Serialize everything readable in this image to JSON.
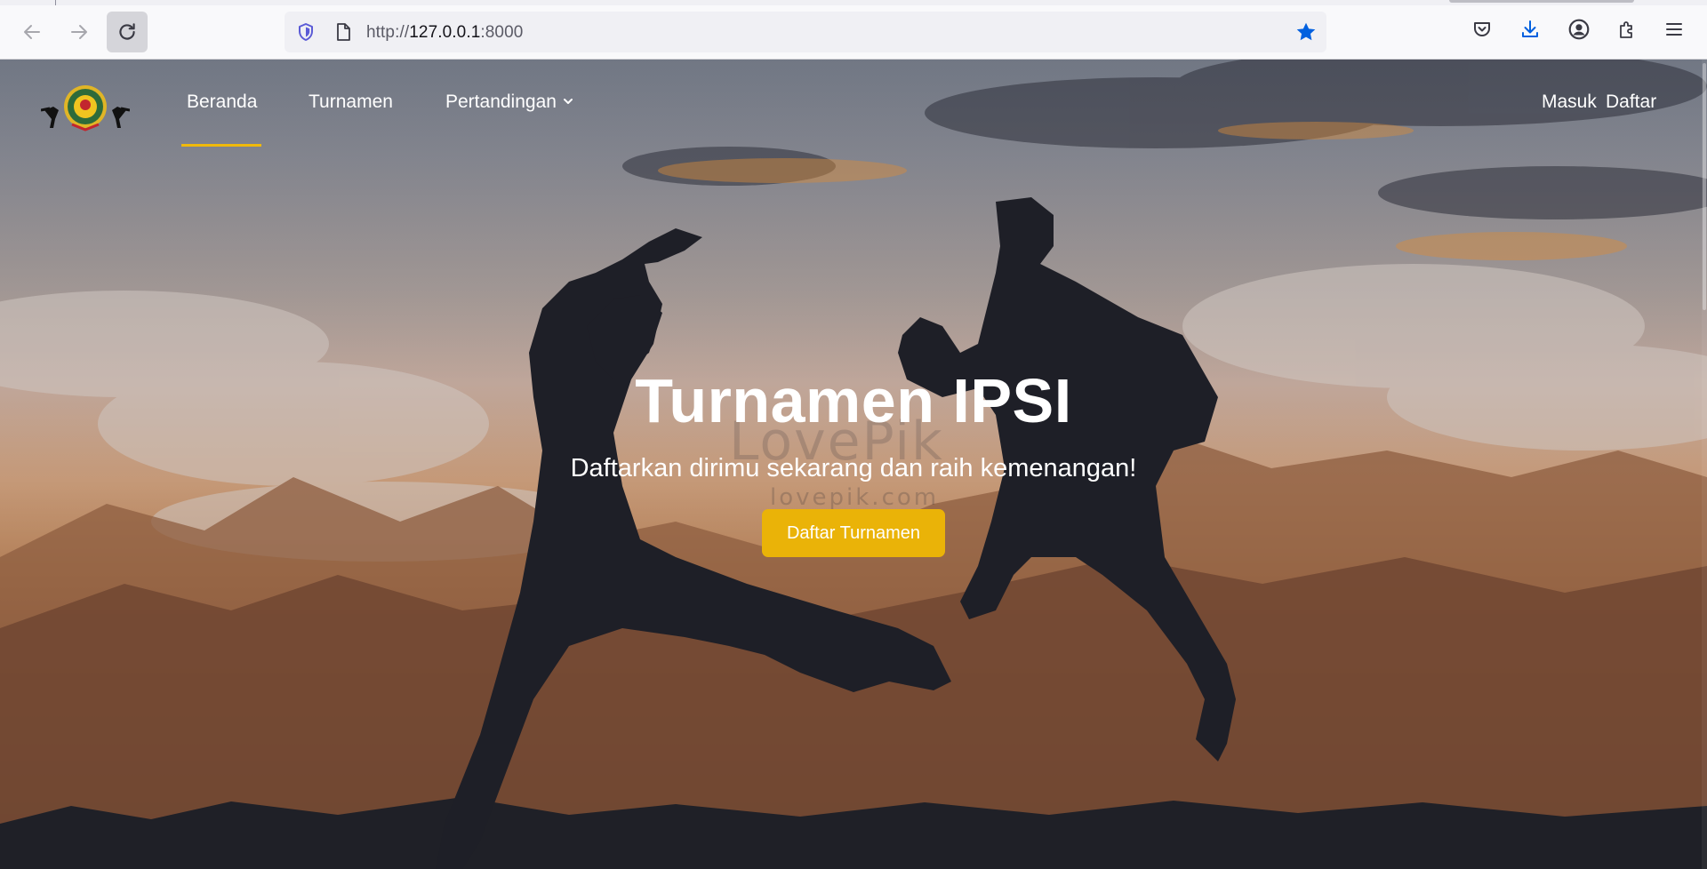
{
  "browser": {
    "url_scheme": "http://",
    "url_host": "127.0.0.1",
    "url_port": ":8000",
    "icons": [
      "back-arrow-icon",
      "forward-arrow-icon",
      "reload-icon",
      "tracking-shield-icon",
      "page-icon",
      "bookmark-star-icon",
      "pocket-icon",
      "download-icon",
      "account-icon",
      "extensions-icon",
      "menu-icon"
    ],
    "accent_color": "#0060df"
  },
  "navbar": {
    "logo": "ipsi-logo",
    "items": [
      {
        "label": "Beranda",
        "active": true
      },
      {
        "label": "Turnamen",
        "active": false
      },
      {
        "label": "Pertandingan",
        "active": false,
        "has_dropdown": true
      }
    ],
    "auth": {
      "login": "Masuk",
      "register": "Daftar"
    },
    "active_color": "#f0b90b"
  },
  "hero": {
    "title": "Turnamen IPSI",
    "subtitle": "Daftarkan dirimu sekarang dan raih kemenangan!",
    "cta_label": "Daftar Turnamen",
    "cta_color": "#eab308",
    "watermark": "lovepik.com"
  }
}
